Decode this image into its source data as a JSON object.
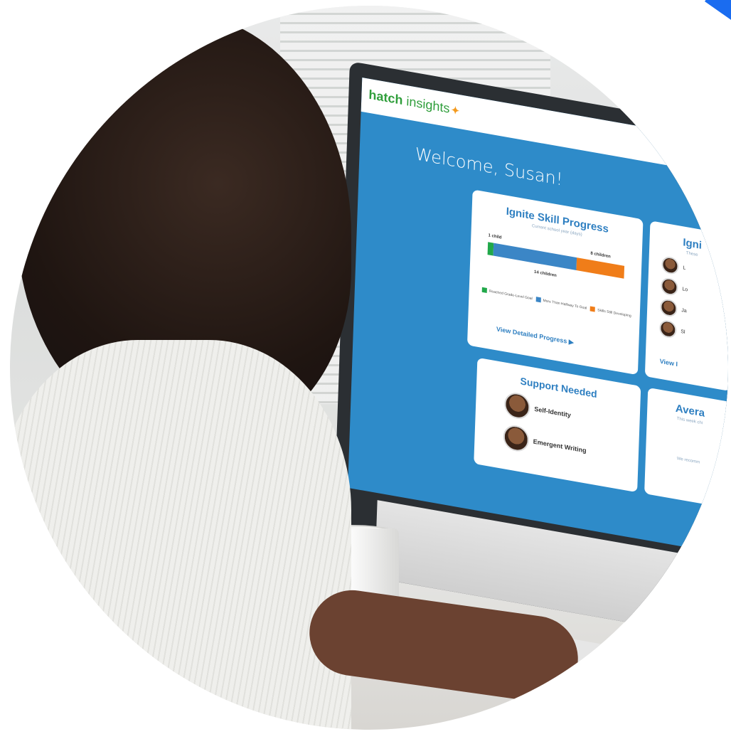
{
  "colors": {
    "accent_corner": "#1a6cf0",
    "screen_blue": "#2e8bc9",
    "brand_green": "#2f9e3b",
    "brand_blue": "#2e7fc1"
  },
  "dashboard": {
    "logo": {
      "bold": "hatch",
      "light": " insights"
    },
    "welcome": "Welcome, Susan!",
    "progress_card": {
      "title": "Ignite Skill Progress",
      "subtitle": "Current school year (days)",
      "labels": {
        "left": "1 child",
        "right": "8 children",
        "middle": "14 children"
      },
      "legend": [
        {
          "label": "Reached Grade-Level Goal",
          "color": "#21a84a"
        },
        {
          "label": "More Than Halfway To Goal",
          "color": "#3b86c6"
        },
        {
          "label": "Skills Still Developing",
          "color": "#f07d19"
        }
      ],
      "link": "View Detailed Progress ▶"
    },
    "children_card": {
      "title": "Igni",
      "subtitle": "These",
      "rows": [
        "L",
        "Lo",
        "Ja",
        "Sl"
      ],
      "link": "View I"
    },
    "support_card": {
      "title": "Support Needed",
      "rows": [
        "Self-Identity",
        "Emergent Writing"
      ]
    },
    "average_card": {
      "title": "Avera",
      "subtitle": "This week chi",
      "note": "We recomm"
    }
  },
  "chart_data": {
    "type": "bar",
    "categories": [
      "Reached Grade-Level Goal",
      "More Than Halfway To Goal",
      "Skills Still Developing"
    ],
    "values": [
      1,
      14,
      8
    ]
  }
}
